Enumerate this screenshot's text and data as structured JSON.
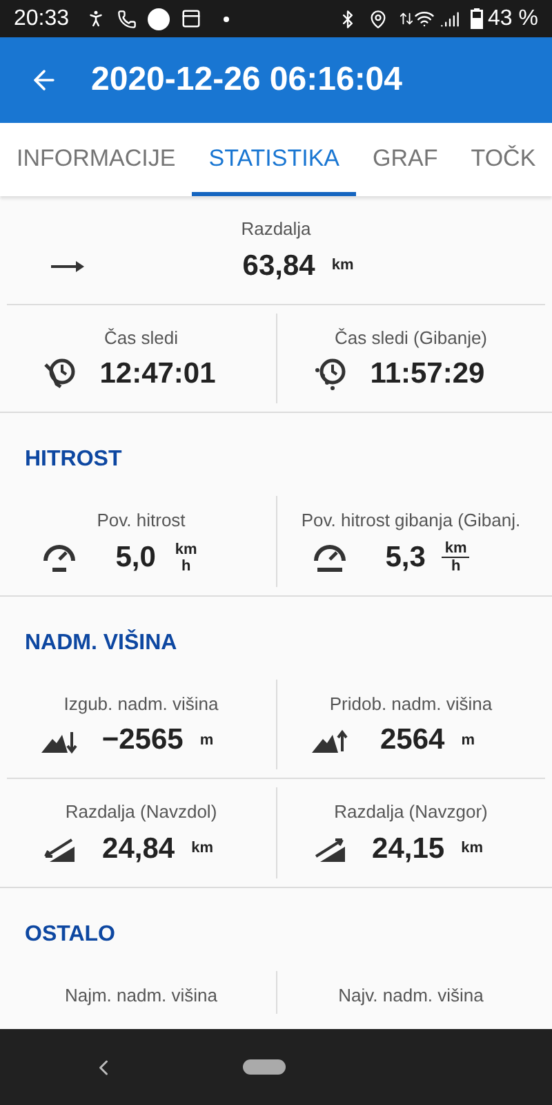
{
  "status_bar": {
    "time": "20:33",
    "battery": "43 %"
  },
  "app_bar": {
    "title": "2020-12-26 06:16:04"
  },
  "tabs": [
    {
      "label": "INFORMACIJE",
      "selected": false
    },
    {
      "label": "STATISTIKA",
      "selected": true
    },
    {
      "label": "GRAF",
      "selected": false
    },
    {
      "label": "TOČK",
      "selected": false
    }
  ],
  "sections": [
    {
      "rows": [
        [
          {
            "label": "Razdalja",
            "value": "63,84",
            "unit": "km",
            "kind": "arrow"
          }
        ],
        [
          {
            "label": "Čas sledi",
            "value": "12:47:01",
            "kind": "clock-track"
          },
          {
            "label": "Čas sledi (Gibanje)",
            "value": "11:57:29",
            "kind": "clock-moving"
          }
        ]
      ]
    },
    {
      "title": "HITROST",
      "rows": [
        [
          {
            "label": "Pov. hitrost",
            "value": "5,0",
            "unit_top": "km",
            "unit_bottom": "h",
            "unit_bar": false,
            "kind": "speed"
          },
          {
            "label": "Pov. hitrost gibanja (Gibanj.",
            "value": "5,3",
            "unit_top": "km",
            "unit_bottom": "h",
            "unit_bar": true,
            "kind": "speed-moving"
          }
        ]
      ]
    },
    {
      "title": "NADM. VIŠINA",
      "rows": [
        [
          {
            "label": "Izgub. nadm. višina",
            "value": "−2565",
            "unit": "m",
            "kind": "descent"
          },
          {
            "label": "Pridob. nadm. višina",
            "value": "2564",
            "unit": "m",
            "kind": "ascent"
          }
        ],
        [
          {
            "label": "Razdalja (Navzdol)",
            "value": "24,84",
            "unit": "km",
            "kind": "slope-down"
          },
          {
            "label": "Razdalja (Navzgor)",
            "value": "24,15",
            "unit": "km",
            "kind": "slope-up"
          }
        ]
      ]
    },
    {
      "title": "OSTALO",
      "rows": [
        [
          {
            "label": "Najm. nadm. višina"
          },
          {
            "label": "Najv. nadm. višina"
          }
        ]
      ]
    }
  ]
}
